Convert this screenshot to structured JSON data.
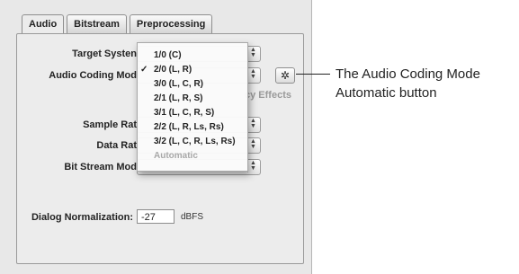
{
  "tabs": [
    "Audio",
    "Bitstream",
    "Preprocessing"
  ],
  "labels": {
    "target_system": "Target Systen",
    "audio_coding_mode": "Audio Coding Mod",
    "sample_rate": "Sample Rat",
    "data_rate": "Data Rat",
    "bit_stream_mode": "Bit Stream Mod",
    "dialog_normalization": "Dialog Normalization:"
  },
  "ghost_text": {
    "lfe": "cy Effects"
  },
  "dialog_normalization": {
    "value": "-27",
    "unit": "dBFS"
  },
  "auto_button_icon": "gear-icon",
  "menu": {
    "items": [
      {
        "label": "1/0 (C)",
        "checked": false,
        "disabled": false
      },
      {
        "label": "2/0 (L, R)",
        "checked": true,
        "disabled": false
      },
      {
        "label": "3/0 (L, C, R)",
        "checked": false,
        "disabled": false
      },
      {
        "label": "2/1 (L, R, S)",
        "checked": false,
        "disabled": false
      },
      {
        "label": "3/1 (L, C, R, S)",
        "checked": false,
        "disabled": false
      },
      {
        "label": "2/2 (L, R, Ls, Rs)",
        "checked": false,
        "disabled": false
      },
      {
        "label": "3/2 (L, C, R, Ls, Rs)",
        "checked": false,
        "disabled": false
      },
      {
        "label": "Automatic",
        "checked": false,
        "disabled": true
      }
    ],
    "check_glyph": "✓"
  },
  "callout": {
    "line1": "The Audio Coding Mode",
    "line2": "Automatic button"
  }
}
